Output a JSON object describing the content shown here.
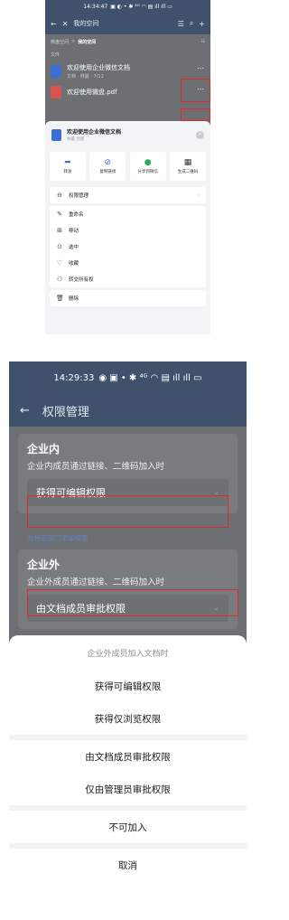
{
  "screen1": {
    "status": {
      "time": "14:34:47",
      "icons": "▣ ◐ • ✱ ⁴ᴳ ◠ ▤ ıll ıll ▭"
    },
    "nav": {
      "back": "←",
      "close": "✕",
      "title": "我的空间",
      "sort_icon": "☰",
      "search_icon": "⌕",
      "add_icon": "+"
    },
    "breadcrumb": {
      "parent": "微盘空间",
      "separator": ">",
      "current": "我的空间",
      "view_icon": "☷"
    },
    "section_label": "文件",
    "files": [
      {
        "name": "欢迎使用企业微信文档",
        "meta": "文档 · 林晨 · 7/12",
        "icon_color": "#3c6fd1",
        "more": "⋯"
      },
      {
        "name": "欢迎使用微盘.pdf",
        "meta": "",
        "icon_color": "#d8534e",
        "more": "⋯"
      }
    ],
    "sheet": {
      "file_name": "欢迎使用企业微信文档",
      "file_meta": "林晨 创建",
      "close_icon": "✕",
      "actions": [
        {
          "icon": "➦",
          "label": "转发",
          "color": "#3c6fd1"
        },
        {
          "icon": "⊘",
          "label": "复制链接",
          "color": "#3c6fd1"
        },
        {
          "icon": "●",
          "label": "分享到微信",
          "color": "#2bae55"
        },
        {
          "icon": "▦",
          "label": "生成二维码",
          "color": "#333333"
        }
      ],
      "permission": {
        "icon": "⊖",
        "label": "权限管理",
        "chevron": "›"
      },
      "menu": [
        {
          "icon": "✎",
          "label": "重命名"
        },
        {
          "icon": "⊞",
          "label": "移动"
        },
        {
          "icon": "⊙",
          "label": "选中"
        },
        {
          "icon": "♡",
          "label": "收藏"
        },
        {
          "icon": "⚇",
          "label": "转交所有权"
        }
      ],
      "delete": {
        "icon": "🗑",
        "label": "删除"
      }
    }
  },
  "screen2": {
    "status": {
      "time": "14:29:33",
      "icons": "◉ ▣ • ✱ ⁴ᴳ ◠ ▤ ıll ıll ▭"
    },
    "nav": {
      "back": "←",
      "title": "权限管理"
    },
    "internal": {
      "title": "企业内",
      "subtitle": "企业内成员通过链接、二维码加入时",
      "value": "获得可编辑权限",
      "chevron": "⌄"
    },
    "add_link": "为特定部门添加权限",
    "external": {
      "title": "企业外",
      "subtitle": "企业外成员通过链接、二维码加入时",
      "value": "由文档成员审批权限",
      "chevron": "⌄"
    },
    "sheet": {
      "title": "企业外成员加入文档时",
      "options": [
        "获得可编辑权限",
        "获得仅浏览权限",
        "由文档成员审批权限",
        "仅由管理员审批权限",
        "不可加入"
      ],
      "cancel": "取消"
    }
  },
  "colors": {
    "accent": "#3c6fd1",
    "highlight": "#e02a2a",
    "nav_bg": "#40526b"
  }
}
